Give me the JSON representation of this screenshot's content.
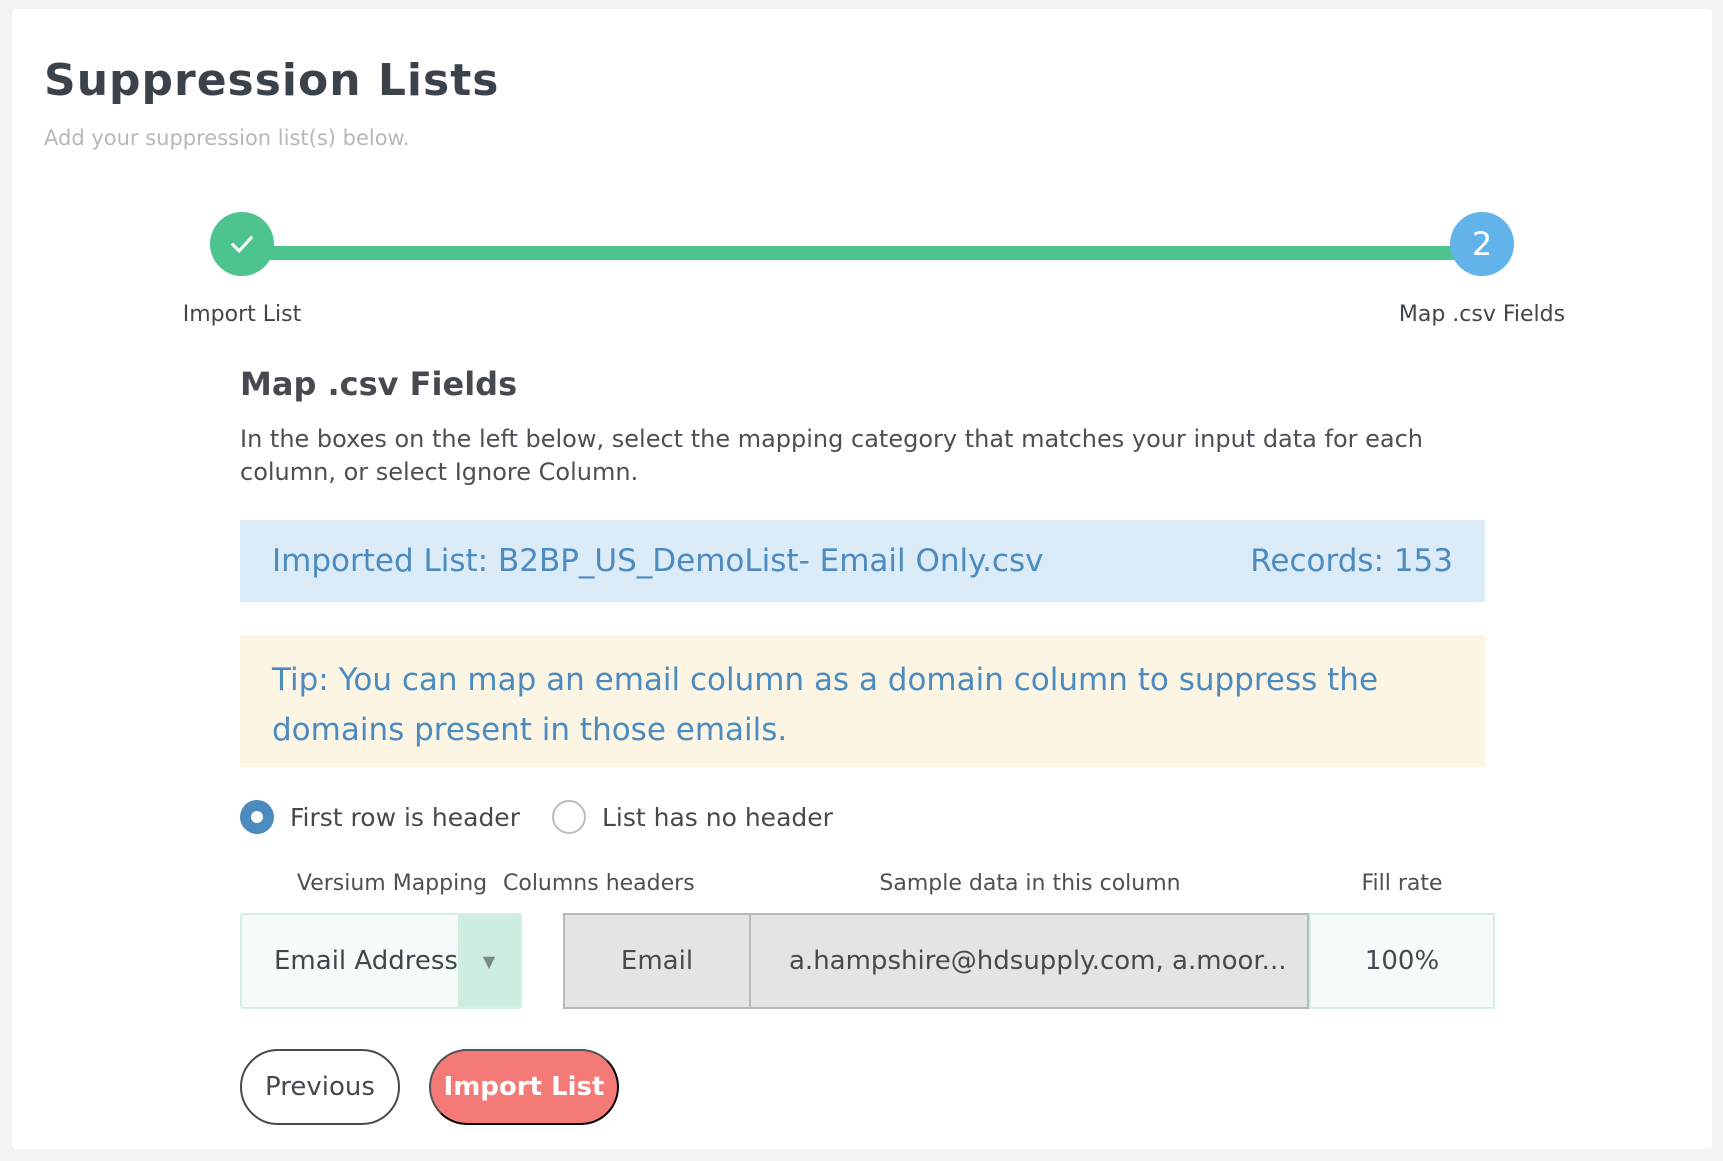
{
  "page": {
    "title": "Suppression Lists",
    "subtitle": "Add your suppression list(s) below."
  },
  "stepper": {
    "steps": [
      {
        "label": "Import List",
        "state": "complete",
        "icon": "check-icon"
      },
      {
        "label": "Map .csv Fields",
        "state": "active",
        "number": "2"
      }
    ]
  },
  "section": {
    "title": "Map .csv Fields",
    "instructions": "In the boxes on the left below, select the mapping category that matches your input data for each column, or select Ignore Column."
  },
  "info_banner": {
    "imported_list": "Imported List: B2BP_US_DemoList- Email Only.csv",
    "records": "Records: 153"
  },
  "tip": {
    "text": "Tip: You can map an email column as a domain column to suppress the domains present in those emails."
  },
  "header_options": {
    "selected": "first_row_is_header",
    "options": [
      {
        "label": "First row is header",
        "checked": true
      },
      {
        "label": "List has no header",
        "checked": false
      }
    ]
  },
  "table": {
    "headers": {
      "mapping": "Versium Mapping",
      "columns": "Columns headers",
      "sample": "Sample data in this column",
      "fill_rate": "Fill rate"
    },
    "rows": [
      {
        "mapping": "Email Address",
        "column_header": "Email",
        "sample": "a.hampshire@hdsupply.com, a.moor...",
        "fill_rate": "100%"
      }
    ]
  },
  "buttons": {
    "previous": "Previous",
    "import": "Import List"
  },
  "colors": {
    "step_complete": "#4dc48e",
    "step_active": "#62b3ea",
    "info_bg": "#dcebf8",
    "tip_bg": "#fdf5e4",
    "link_text": "#4b8bbf",
    "primary_button": "#f47a78"
  }
}
